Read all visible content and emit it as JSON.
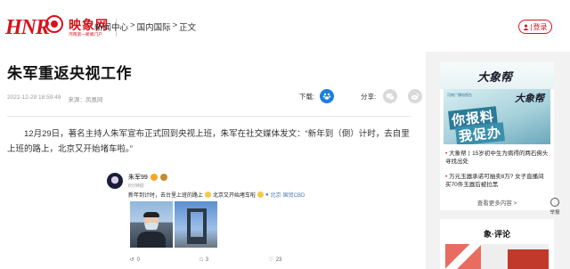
{
  "header": {
    "logo_mark": "HNR",
    "logo_name": "映象网",
    "logo_slogan": "河南第一新闻门户",
    "breadcrumb": [
      "新闻中心",
      ">",
      "国内国际",
      ">",
      "正文"
    ],
    "login_label": "登录"
  },
  "article": {
    "title": "朱军重返央视工作",
    "date": "2022-12-29 18:59:49",
    "source": "来源：凤凰网",
    "download_label": "下载:",
    "share_label": "分享:",
    "paragraph": "12月29日，著名主持人朱军宣布正式回到央视上班，朱军在社交媒体发文：“新年到（倒）计时，去自里上班的路上，北京又开始堵车啦。”"
  },
  "weibo": {
    "user": "朱军99",
    "time": "8分钟前",
    "text": "新年到计时，去台里上班的路上",
    "text_tail": "北京又开始堵车啦",
    "location": "北京·国贸CBD",
    "reposts": "0",
    "comments": "3",
    "likes": "23"
  },
  "sidebar": {
    "brand": "大象帮",
    "banner_tag": "河南广播电视台",
    "banner_line1": "你报料",
    "banner_line2": "我促办",
    "news": [
      "大象帮丨15岁初中生为病得的两石佛头寻找出处",
      "万元玉器承诺可抽卖8万? 女子直播间买70件玉器后被拉黑"
    ],
    "more_label": "查看更多内容 >"
  },
  "float_button": {
    "label": "举报"
  },
  "comments": {
    "title": "象·评论"
  },
  "colors": {
    "brand_red": "#d7121c",
    "weibo_blue": "#1a7fe0"
  },
  "icons": {
    "login": "user-icon",
    "download": "paw-icon",
    "share_wechat": "wechat-icon",
    "share_weibo": "weibo-icon",
    "report": "warning-icon"
  }
}
